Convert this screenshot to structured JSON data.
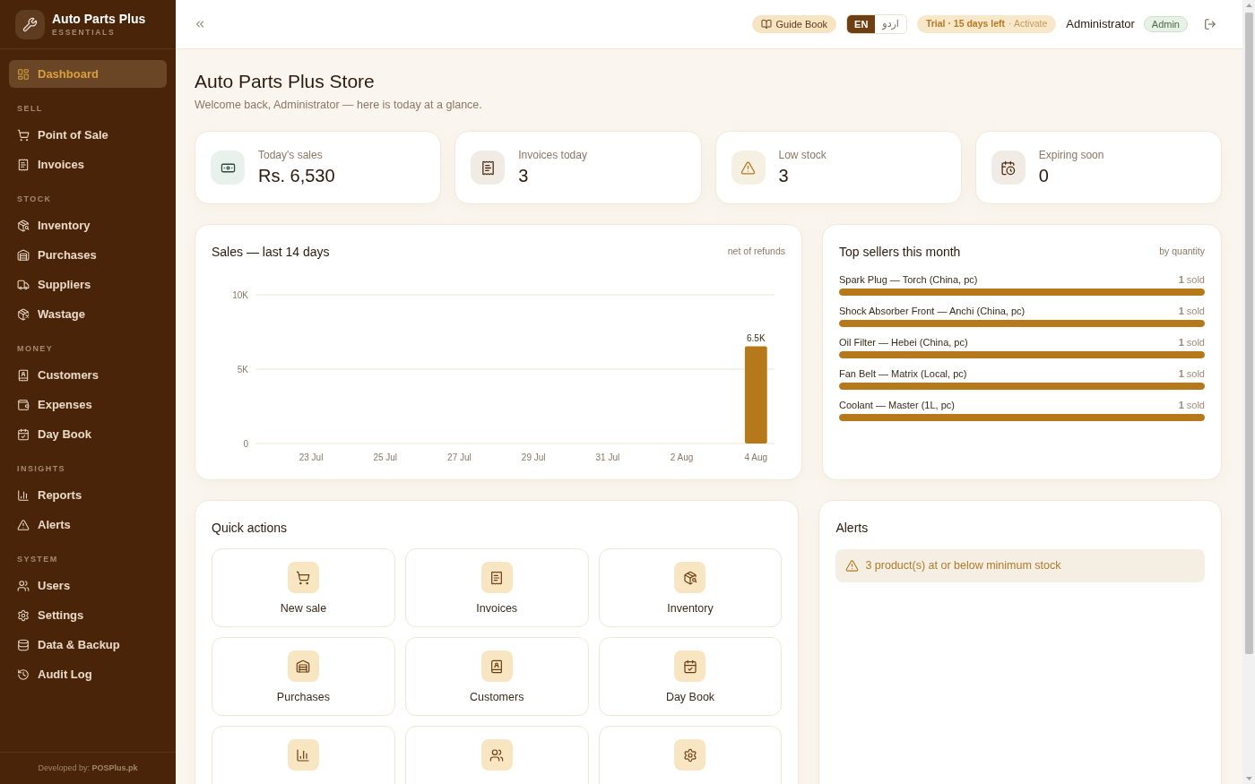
{
  "sidebar": {
    "brand": {
      "name": "Auto Parts Plus",
      "tagline": "ESSENTIALS"
    },
    "items": [
      {
        "label": "Dashboard",
        "selected": true
      }
    ],
    "sections": [
      {
        "title": "SELL",
        "items": [
          {
            "label": "Point of Sale",
            "selected": false
          },
          {
            "label": "Invoices",
            "selected": false
          }
        ]
      },
      {
        "title": "STOCK",
        "items": [
          {
            "label": "Inventory",
            "selected": false
          },
          {
            "label": "Purchases",
            "selected": false
          },
          {
            "label": "Suppliers",
            "selected": false
          },
          {
            "label": "Wastage",
            "selected": false
          }
        ]
      },
      {
        "title": "MONEY",
        "items": [
          {
            "label": "Customers",
            "selected": false
          },
          {
            "label": "Expenses",
            "selected": false
          },
          {
            "label": "Day Book",
            "selected": false
          }
        ]
      },
      {
        "title": "INSIGHTS",
        "items": [
          {
            "label": "Reports",
            "selected": false
          },
          {
            "label": "Alerts",
            "selected": false
          }
        ]
      },
      {
        "title": "SYSTEM",
        "items": [
          {
            "label": "Users",
            "selected": false
          },
          {
            "label": "Settings",
            "selected": false
          },
          {
            "label": "Data & Backup",
            "selected": false
          },
          {
            "label": "Audit Log",
            "selected": false
          }
        ]
      }
    ],
    "footer": "Developed by: **POSPlus.pk**"
  },
  "header": {
    "guide_button": "Guide Book",
    "languages": [
      {
        "label": "EN",
        "selected": true
      },
      {
        "label": "اردو",
        "selected": false
      }
    ],
    "trial": {
      "status": "Trial · 15 days left",
      "action": "· Activate"
    },
    "user": {
      "name": "Administrator",
      "role": "Admin"
    }
  },
  "page": {
    "title": "Auto Parts Plus Store",
    "subtitle": "Welcome back, Administrator — here is today at a glance."
  },
  "stats": [
    {
      "label": "Today's sales",
      "value": "Rs. 6,530"
    },
    {
      "label": "Invoices today",
      "value": "3"
    },
    {
      "label": "Low stock",
      "value": "3"
    },
    {
      "label": "Expiring soon",
      "value": "0"
    }
  ],
  "sales_chart": {
    "title": "Sales — last 14 days",
    "note": "net of refunds",
    "chart_data": {
      "type": "bar",
      "categories": [
        null,
        "23 Jul",
        null,
        "25 Jul",
        null,
        "27 Jul",
        null,
        "29 Jul",
        null,
        "31 Jul",
        null,
        "2 Aug",
        null,
        "4 Aug"
      ],
      "values": [
        0,
        0,
        0,
        0,
        0,
        0,
        0,
        0,
        0,
        0,
        0,
        0,
        0,
        6530
      ],
      "ylim": [
        0,
        10000
      ],
      "yticks": [
        {
          "value": 0,
          "label": "0"
        },
        {
          "value": 5000,
          "label": "5K"
        },
        {
          "value": 10000,
          "label": "10K"
        }
      ],
      "value_labels": [
        null,
        null,
        null,
        null,
        null,
        null,
        null,
        null,
        null,
        null,
        null,
        null,
        null,
        "6.5K"
      ]
    }
  },
  "top_sellers": {
    "title": "Top sellers this month",
    "note": "by quantity",
    "items": [
      {
        "name": "Spark Plug — Torch (China, pc)",
        "sold": "**1** sold",
        "level": 1
      },
      {
        "name": "Shock Absorber Front — Anchi (China, pc)",
        "sold": "**1** sold",
        "level": 1
      },
      {
        "name": "Oil Filter — Hebei (China, pc)",
        "sold": "**1** sold",
        "level": 1
      },
      {
        "name": "Fan Belt — Matrix (Local, pc)",
        "sold": "**1** sold",
        "level": 1
      },
      {
        "name": "Coolant — Master (1L, pc)",
        "sold": "**1** sold",
        "level": 1
      }
    ]
  },
  "quick_actions": {
    "title": "Quick actions",
    "items": [
      {
        "label": "New sale"
      },
      {
        "label": "Invoices"
      },
      {
        "label": "Inventory"
      },
      {
        "label": "Purchases"
      },
      {
        "label": "Customers"
      },
      {
        "label": "Day Book"
      }
    ]
  },
  "alerts": {
    "title": "Alerts",
    "items": [
      {
        "text": "3 product(s) at or below minimum stock"
      }
    ]
  }
}
